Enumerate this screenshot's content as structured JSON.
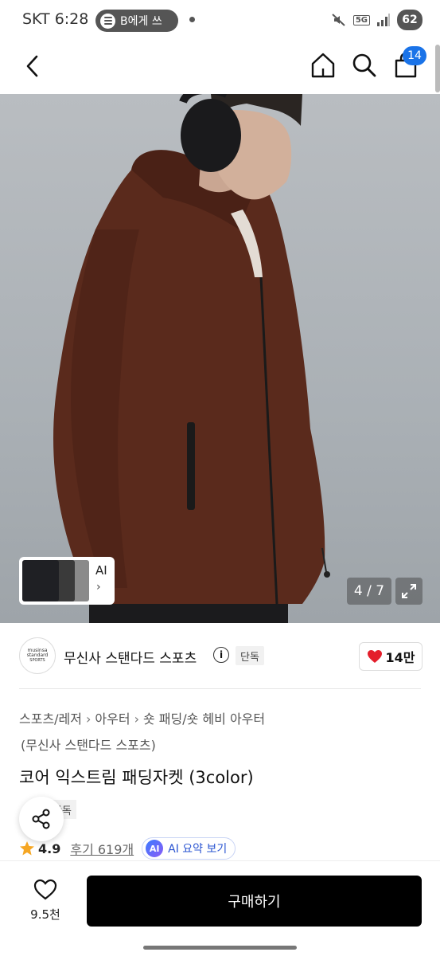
{
  "status_bar": {
    "carrier_time": "SKT 6:28",
    "music_label": "B에게 쓰",
    "network": "5G",
    "battery": "62"
  },
  "header": {
    "cart_count": "14"
  },
  "gallery": {
    "thumbnail_label": "AI",
    "thumbnail_chevron": "›",
    "page_indicator": "4 / 7"
  },
  "brand": {
    "logo_line1": "musinsa",
    "logo_line2": "standard",
    "logo_line3": "SPORTS",
    "name": "무신사 스탠다드 스포츠",
    "info_glyph": "i",
    "exclusive_tag": "단독",
    "like_count": "14만"
  },
  "breadcrumb": {
    "items": [
      "스포츠/레저",
      "아우터",
      "숏 패딩/숏 헤비 아우터"
    ],
    "separator": "›",
    "brand_sub": "(무신사 스탠다드 스포츠)"
  },
  "product": {
    "title": "코어 익스트림 패딩자켓 (3color)",
    "exclusive_tag": "단독",
    "rating": "4.9",
    "reviews": "후기 619개",
    "ai_badge": "AI",
    "ai_summary": "AI 요약 보기"
  },
  "bottom": {
    "wish_count": "9.5천",
    "buy_label": "구매하기"
  },
  "colors": {
    "jacket": "#5a2a1c",
    "accent_blue": "#1a73e8",
    "heart_red": "#e41e2b",
    "star_yellow": "#f5a623"
  }
}
